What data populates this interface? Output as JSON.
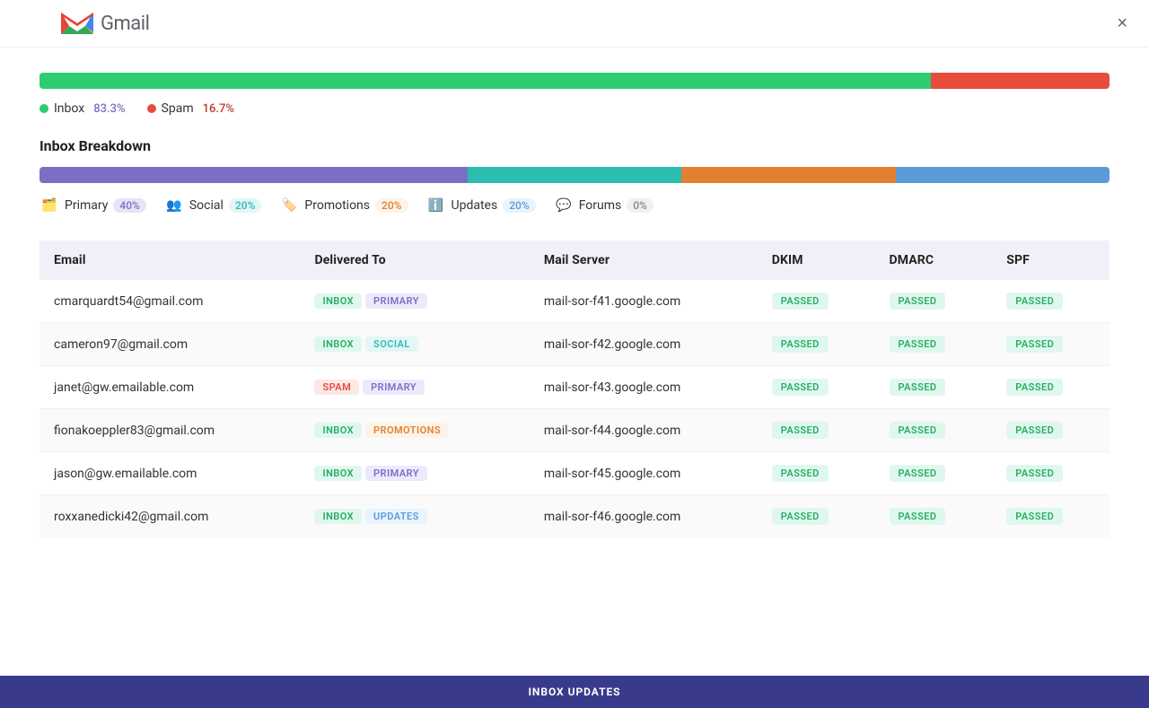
{
  "header": {
    "title": "Gmail",
    "close_label": "×"
  },
  "chart": {
    "inbox_pct": 83.3,
    "spam_pct": 16.7,
    "inbox_label": "Inbox",
    "spam_label": "Spam",
    "inbox_pct_display": "83.3%",
    "spam_pct_display": "16.7%"
  },
  "breakdown": {
    "title": "Inbox Breakdown",
    "segments": [
      {
        "label": "Primary",
        "pct": 40,
        "display": "40%",
        "color": "#7b6fc4",
        "pct_class": "pct-primary",
        "icon": "🗂️"
      },
      {
        "label": "Social",
        "pct": 20,
        "display": "20%",
        "color": "#2dbcb0",
        "pct_class": "pct-social",
        "icon": "👥"
      },
      {
        "label": "Promotions",
        "pct": 20,
        "display": "20%",
        "color": "#e08030",
        "pct_class": "pct-promotions",
        "icon": "🏷️"
      },
      {
        "label": "Updates",
        "pct": 20,
        "display": "20%",
        "color": "#5b9bd5",
        "pct_class": "pct-updates",
        "icon": "ℹ️"
      },
      {
        "label": "Forums",
        "pct": 0,
        "display": "0%",
        "color": "#b78fd4",
        "pct_class": "pct-forums",
        "icon": "💬"
      }
    ]
  },
  "table": {
    "columns": [
      "Email",
      "Delivered To",
      "Mail Server",
      "DKIM",
      "DMARC",
      "SPF"
    ],
    "rows": [
      {
        "email": "cmarquardt54@gmail.com",
        "tags": [
          {
            "label": "INBOX",
            "class": "tag-inbox"
          },
          {
            "label": "PRIMARY",
            "class": "tag-primary"
          }
        ],
        "server": "mail-sor-f41.google.com",
        "dkim": "PASSED",
        "dmarc": "PASSED",
        "spf": "PASSED"
      },
      {
        "email": "cameron97@gmail.com",
        "tags": [
          {
            "label": "INBOX",
            "class": "tag-inbox"
          },
          {
            "label": "SOCIAL",
            "class": "tag-social"
          }
        ],
        "server": "mail-sor-f42.google.com",
        "dkim": "PASSED",
        "dmarc": "PASSED",
        "spf": "PASSED"
      },
      {
        "email": "janet@gw.emailable.com",
        "tags": [
          {
            "label": "SPAM",
            "class": "tag-spam"
          },
          {
            "label": "PRIMARY",
            "class": "tag-primary"
          }
        ],
        "server": "mail-sor-f43.google.com",
        "dkim": "PASSED",
        "dmarc": "PASSED",
        "spf": "PASSED"
      },
      {
        "email": "fionakoeppler83@gmail.com",
        "tags": [
          {
            "label": "INBOX",
            "class": "tag-inbox"
          },
          {
            "label": "PROMOTIONS",
            "class": "tag-promotions"
          }
        ],
        "server": "mail-sor-f44.google.com",
        "dkim": "PASSED",
        "dmarc": "PASSED",
        "spf": "PASSED"
      },
      {
        "email": "jason@gw.emailable.com",
        "tags": [
          {
            "label": "INBOX",
            "class": "tag-inbox"
          },
          {
            "label": "PRIMARY",
            "class": "tag-primary"
          }
        ],
        "server": "mail-sor-f45.google.com",
        "dkim": "PASSED",
        "dmarc": "PASSED",
        "spf": "PASSED"
      },
      {
        "email": "roxxanedicki42@gmail.com",
        "tags": [
          {
            "label": "INBOX",
            "class": "tag-inbox"
          },
          {
            "label": "UPDATES",
            "class": "tag-updates"
          }
        ],
        "server": "mail-sor-f46.google.com",
        "dkim": "PASSED",
        "dmarc": "PASSED",
        "spf": "PASSED"
      }
    ]
  },
  "bottom_bar": {
    "label": "INBOX UPDATES"
  }
}
